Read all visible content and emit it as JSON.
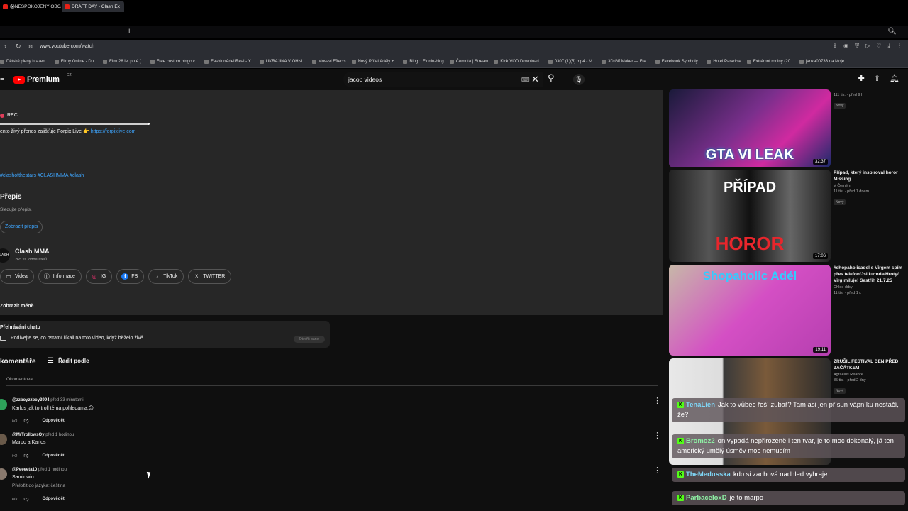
{
  "browser": {
    "tabs": [
      {
        "label": "😱NESPOKOJENÝ OBČAN"
      },
      {
        "label": "DRAFT DAY - Clash Ex"
      }
    ],
    "new_tab": "+",
    "url": "www.youtube.com/watch",
    "bookmarks": [
      "Dětské pleny hrazen...",
      "Filmy Online - Du...",
      "Film 28 let poté (...",
      "Free custom bingo c...",
      "FashionAdelIReal - Y...",
      "UKRAJINA V OHNI...",
      "Movavi Effects",
      "Nový Přítel Adély +...",
      "Blog :: Fionin-blog",
      "Černota | Stream",
      "Kick VOD Download...",
      "0307 (1)(5).mp4 - M...",
      "3D Gif Maker — Fre...",
      "Facebook Symboly...",
      "Hotel Paradise",
      "Extrémní rodiny (20...",
      "janka00733 na Moje..."
    ]
  },
  "youtube": {
    "logo_text": "Premium",
    "logo_region": "CZ",
    "search_value": "jacob videos"
  },
  "description": {
    "rec": "REC",
    "line_text": "ento živý přenos zajišťuje Forpix Live 👉",
    "line_link": "https://forpixlive.com",
    "hashtags": "#clashofthestars #CLASHMMA #clash",
    "transcript_heading": "Přepis",
    "transcript_sub": "Sledujte přepis.",
    "transcript_button": "Zobrazit přepis",
    "channel_avatar": "CLASH",
    "channel_name": "Clash MMA",
    "channel_subs": "265 tis. odběratelů",
    "chips": [
      {
        "label": "Videa",
        "icon": "▭"
      },
      {
        "label": "Informace",
        "icon": "ⓘ"
      },
      {
        "label": "IG",
        "icon": "◎"
      },
      {
        "label": "FB",
        "icon": "f"
      },
      {
        "label": "TikTok",
        "icon": "♪"
      },
      {
        "label": "TWITTER",
        "icon": "X"
      }
    ],
    "show_less": "Zobrazit méně"
  },
  "chat_replay": {
    "title": "Přehrávání chatu",
    "text": "Podívejte se, co ostatní říkali na toto video, když běželo živě.",
    "button": "Otevřít panel"
  },
  "comments": {
    "heading": "komentáře",
    "sort_label": "Řadit podle",
    "add_placeholder": "Okomentovat...",
    "reply_label": "Odpovědět",
    "items": [
      {
        "user": "@zzboyzzboy3994",
        "time": "před 33 minutami",
        "text": "Karlos jak to troll téma pohledama.😊",
        "translate": ""
      },
      {
        "user": "@MrTrollowsOy",
        "time": "před 1 hodinou",
        "text": "Marpo a Karlos",
        "translate": ""
      },
      {
        "user": "@Peeeeta10",
        "time": "před 1 hodinou",
        "text": "Samir win",
        "translate": "Přeložit do jazyka: čeština"
      }
    ]
  },
  "sidebar": [
    {
      "thumb_text": "GTA VI LEAK",
      "duration": "32:37",
      "title": "",
      "channel": "",
      "meta": "111 tis. · před 9 h",
      "badge": "Nový"
    },
    {
      "thumb_text": "PŘÍPAD",
      "duration": "17:06",
      "title": "Případ, který inspiroval horor Missing",
      "channel": "V Černém",
      "meta": "11 tis. · před 1 dnem",
      "badge": "Nový"
    },
    {
      "thumb_text": "Shopaholic Adél",
      "duration": "19:11",
      "title": "#shopaholicadel s Virgem spím přes telefon/Jsi ku*nda/Hroty/ Virg miluje! Sestřih 21.7.25",
      "channel": "Chloe drby",
      "meta": "11 tis. · před 1 r.",
      "badge": ""
    },
    {
      "thumb_text": "",
      "duration": "",
      "title": "ZRUŠIL FESTIVAL DEN PŘED ZAČÁTKEM",
      "channel": "Agraelus Reakce",
      "meta": "85 tis. · před 2 dny",
      "badge": "Nový"
    }
  ],
  "overlay_chat": [
    {
      "user": "TenaLien",
      "text": "Jak to vůbec řeší zubař? Tam asi jen přísun vápníku nestačí, že?"
    },
    {
      "user": "Bromoz2",
      "text": "on vypadá nepřirozeně i ten tvar, je to moc dokonalý, já ten americký umělý úsměv moc nemusím"
    },
    {
      "user": "TheMedusska",
      "text": "kdo si zachová nadhled vyhraje"
    },
    {
      "user": "ParbaceloxD",
      "text": "je to marpo"
    }
  ]
}
